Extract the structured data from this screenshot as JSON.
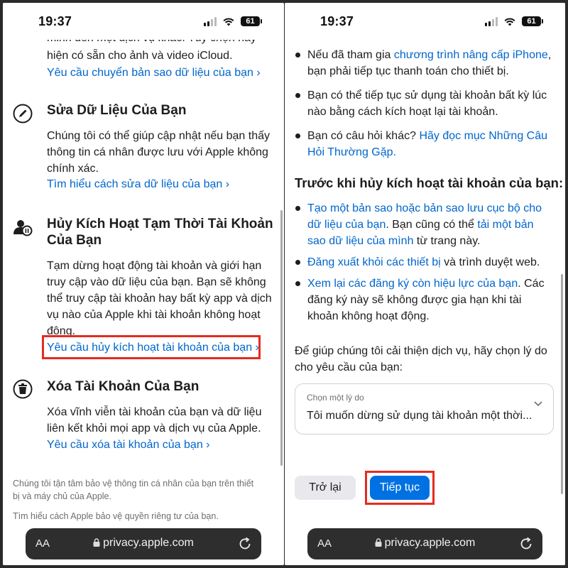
{
  "status": {
    "time": "19:37",
    "battery": "61"
  },
  "address_bar": {
    "text_size": "AA",
    "url": "privacy.apple.com"
  },
  "left": {
    "top_text": [
      "minh đến một dịch vụ khác. Tùy chọn này",
      "hiện có sẵn cho ảnh và video iCloud."
    ],
    "top_link": "Yêu cầu chuyển bản sao dữ liệu của bạn ›",
    "edit": {
      "title": "Sửa Dữ Liệu Của Bạn",
      "body": [
        "Chúng tôi có thể giúp cập nhật nếu bạn thấy",
        "thông tin cá nhân được lưu với Apple không",
        "chính xác."
      ],
      "link": "Tìm hiểu cách sửa dữ liệu của bạn ›"
    },
    "deactivate": {
      "title": [
        "Hủy Kích Hoạt Tạm Thời Tài Khoản",
        "Của Bạn"
      ],
      "body": [
        "Tạm dừng hoạt động tài khoản và giới hạn",
        "truy cập vào dữ liệu của bạn. Bạn sẽ không",
        "thể truy cập tài khoản hay bất kỳ app và dịch",
        "vụ nào của Apple khi tài khoản không hoạt",
        "động."
      ],
      "link": "Yêu cầu hủy kích hoạt tài khoản của bạn ›"
    },
    "delete": {
      "title": "Xóa Tài Khoản Của Bạn",
      "body": [
        "Xóa vĩnh viễn tài khoản của bạn và dữ liệu",
        "liên kết khỏi mọi app và dịch vụ của Apple."
      ],
      "link": "Yêu cầu xóa tài khoản của bạn ›"
    },
    "footer": [
      "Chúng tôi tận tâm bảo vệ thông tin cá nhân của bạn trên thiết",
      "bị và máy chủ của Apple."
    ],
    "footer_link": "Tìm hiểu cách Apple bảo vệ quyền riêng tư của bạn."
  },
  "right": {
    "bullets_top": [
      {
        "pre": "Nếu đã tham gia ",
        "link": "chương trình nâng cấp iPhone",
        "post": ", bạn phải tiếp tục thanh toán cho thiết bị."
      },
      {
        "pre": "Bạn có thể tiếp tục sử dụng tài khoản bất kỳ lúc nào bằng cách kích hoạt lại tài khoản.",
        "link": "",
        "post": ""
      },
      {
        "pre": "Bạn có câu hỏi khác? ",
        "link": "Hãy đọc mục Những Câu Hỏi Thường Gặp.",
        "post": ""
      }
    ],
    "heading": "Trước khi hủy kích hoạt tài khoản của bạn:",
    "bullets_before": [
      {
        "link1": "Tạo một bản sao hoặc bản sao lưu cục bộ cho dữ liệu của bạn",
        "mid": ". Bạn cũng có thể ",
        "link2": "tải một bản sao dữ liệu của mình",
        "post": " từ trang này."
      },
      {
        "link1": "Đăng xuất khỏi các thiết bị",
        "mid": " và trình duyệt web.",
        "link2": "",
        "post": ""
      },
      {
        "link1": "Xem lại các đăng ký còn hiệu lực của bạn",
        "mid": ". Các đăng ký này sẽ không được gia hạn khi tài khoản không hoạt động.",
        "link2": "",
        "post": ""
      }
    ],
    "prompt": "Để giúp chúng tôi cải thiện dịch vụ, hãy chọn lý do cho yêu cầu của bạn:",
    "select": {
      "label": "Chọn một lý do",
      "value": "Tôi muốn dừng sử dụng tài khoản một thời..."
    },
    "back_button": "Trở lại",
    "continue_button": "Tiếp tục"
  },
  "colors": {
    "link": "#0066cc",
    "primary_button": "#0071e3",
    "highlight": "#e52b20"
  }
}
